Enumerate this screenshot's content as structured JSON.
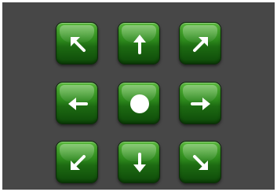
{
  "dpad": {
    "buttons": [
      {
        "id": "up-left",
        "icon": "arrow-up-left-icon"
      },
      {
        "id": "up",
        "icon": "arrow-up-icon"
      },
      {
        "id": "up-right",
        "icon": "arrow-up-right-icon"
      },
      {
        "id": "left",
        "icon": "arrow-left-icon"
      },
      {
        "id": "center",
        "icon": "circle-icon"
      },
      {
        "id": "right",
        "icon": "arrow-right-icon"
      },
      {
        "id": "down-left",
        "icon": "arrow-down-left-icon"
      },
      {
        "id": "down",
        "icon": "arrow-down-icon"
      },
      {
        "id": "down-right",
        "icon": "arrow-down-right-icon"
      }
    ]
  },
  "colors": {
    "background": "#474747",
    "button_top": "#58b83a",
    "button_bottom": "#0e4a09",
    "icon": "#ffffff"
  }
}
